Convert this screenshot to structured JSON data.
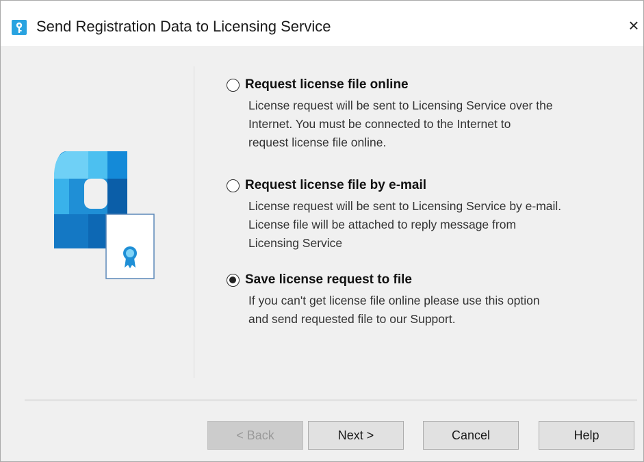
{
  "window": {
    "title": "Send Registration Data to Licensing Service",
    "close_glyph": "×"
  },
  "options": [
    {
      "label": "Request license file online",
      "description": "License request will be sent to Licensing Service over the\nInternet. You must be connected to the Internet to\nrequest license file online.",
      "selected": false
    },
    {
      "label": "Request license file by e-mail",
      "description": "License request will be sent to Licensing Service by e-mail.\nLicense file will be attached to reply message from\nLicensing Service",
      "selected": false
    },
    {
      "label": "Save license request to file",
      "description": "If you can't get license file online please use this option\nand send requested file to our Support.",
      "selected": true
    }
  ],
  "buttons": {
    "back": "< Back",
    "next": "Next >",
    "cancel": "Cancel",
    "help": "Help"
  },
  "icons": {
    "app": "app-key-icon",
    "illustration": "license-certificate-icon"
  },
  "colors": {
    "brand_blue": "#1f8fd6",
    "brand_dark": "#0b5ea8"
  }
}
